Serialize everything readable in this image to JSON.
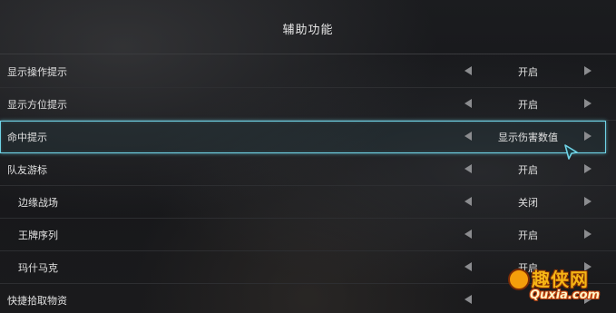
{
  "title": "辅助功能",
  "rows": [
    {
      "label": "显示操作提示",
      "value": "开启",
      "indent": false,
      "selected": false
    },
    {
      "label": "显示方位提示",
      "value": "开启",
      "indent": false,
      "selected": false
    },
    {
      "label": "命中提示",
      "value": "显示伤害数值",
      "indent": false,
      "selected": true
    },
    {
      "label": "队友游标",
      "value": "开启",
      "indent": false,
      "selected": false
    },
    {
      "label": "边缘战场",
      "value": "关闭",
      "indent": true,
      "selected": false
    },
    {
      "label": "王牌序列",
      "value": "开启",
      "indent": true,
      "selected": false
    },
    {
      "label": "玛什马克",
      "value": "开启",
      "indent": true,
      "selected": false
    },
    {
      "label": "快捷拾取物资",
      "value": "",
      "indent": false,
      "selected": false
    }
  ],
  "watermark": {
    "text_cn": "趣侠网",
    "text_en": "Quxia.com"
  },
  "colors": {
    "highlight": "#6fd3e6",
    "text": "#e2e2e2",
    "arrow": "#8b8c8f"
  }
}
